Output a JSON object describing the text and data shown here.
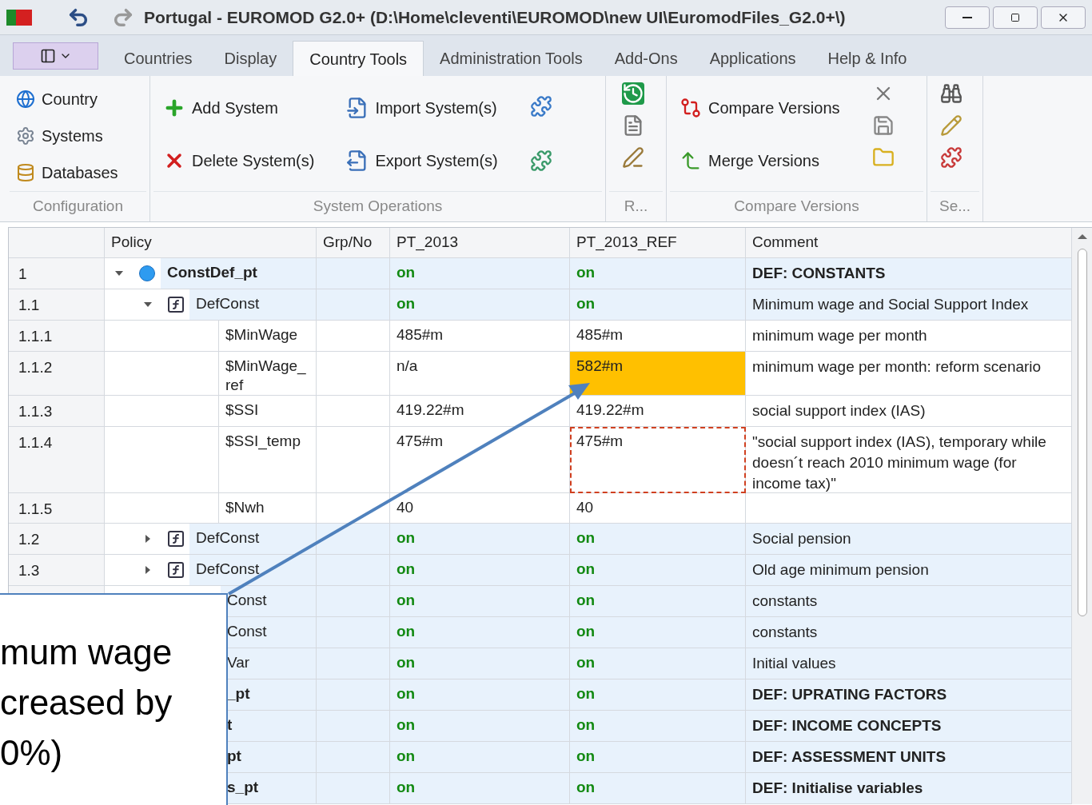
{
  "window": {
    "title": "Portugal - EUROMOD G2.0+ (D:\\Home\\cleventi\\EUROMOD\\new UI\\EuromodFiles_G2.0+\\)"
  },
  "tabs": [
    {
      "label": "Countries",
      "selected": false
    },
    {
      "label": "Display",
      "selected": false
    },
    {
      "label": "Country Tools",
      "selected": true
    },
    {
      "label": "Administration Tools",
      "selected": false
    },
    {
      "label": "Add-Ons",
      "selected": false
    },
    {
      "label": "Applications",
      "selected": false
    },
    {
      "label": "Help & Info",
      "selected": false
    }
  ],
  "ribbon": [
    {
      "label": "Configuration",
      "buttons": [
        "Country",
        "Systems",
        "Databases"
      ]
    },
    {
      "label": "System Operations",
      "buttons": [
        "Add System",
        "Delete System(s)",
        "Import System(s)",
        "Export System(s)"
      ]
    },
    {
      "label": "R..."
    },
    {
      "label": "Compare Versions",
      "buttons": [
        "Compare Versions",
        "Merge Versions"
      ]
    },
    {
      "label": "Se..."
    }
  ],
  "table": {
    "columns": [
      "Policy",
      "Grp/No",
      "PT_2013",
      "PT_2013_REF",
      "Comment"
    ],
    "rows": [
      {
        "number": "1",
        "policy": "ConstDef_pt",
        "kind": "policy",
        "expanded": true,
        "pt_2013": "on",
        "pt_2013_ref": "on",
        "ref_highlighted": false,
        "ref_focused": false,
        "comment": "DEF: CONSTANTS",
        "children": [
          {
            "number": "1.1",
            "policy": "DefConst",
            "kind": "function",
            "expanded": true,
            "pt_2013": "on",
            "pt_2013_ref": "on",
            "ref_highlighted": false,
            "ref_focused": false,
            "comment": "Minimum wage and Social Support Index",
            "children": [
              {
                "number": "1.1.1",
                "policy": "$MinWage",
                "kind": "parameter",
                "pt_2013": "485#m",
                "pt_2013_ref": "485#m",
                "ref_highlighted": false,
                "ref_focused": false,
                "comment": "minimum wage per month"
              },
              {
                "number": "1.1.2",
                "policy": "$MinWage_ref",
                "kind": "parameter",
                "pt_2013": "n/a",
                "pt_2013_ref": "582#m",
                "ref_highlighted": true,
                "ref_focused": false,
                "comment": "minimum wage per month: reform scenario"
              },
              {
                "number": "1.1.3",
                "policy": "$SSI",
                "kind": "parameter",
                "pt_2013": "419.22#m",
                "pt_2013_ref": "419.22#m",
                "ref_highlighted": false,
                "ref_focused": false,
                "comment": "social support index (IAS)"
              },
              {
                "number": "1.1.4",
                "policy": "$SSI_temp",
                "kind": "parameter",
                "pt_2013": "475#m",
                "pt_2013_ref": "475#m",
                "ref_highlighted": false,
                "ref_focused": true,
                "comment": "\"social support index (IAS), temporary while doesn´t reach 2010 minimum wage (for income tax)\""
              },
              {
                "number": "1.1.5",
                "policy": "$Nwh",
                "kind": "parameter",
                "pt_2013": "40",
                "pt_2013_ref": "40",
                "ref_highlighted": false,
                "ref_focused": false
              }
            ]
          },
          {
            "number": "1.2",
            "policy": "DefConst",
            "kind": "function",
            "expanded": false,
            "pt_2013": "on",
            "pt_2013_ref": "on",
            "ref_highlighted": false,
            "ref_focused": false,
            "comment": "Social pension"
          },
          {
            "number": "1.3",
            "policy": "DefConst",
            "kind": "function",
            "expanded": false,
            "pt_2013": "on",
            "pt_2013_ref": "on",
            "ref_highlighted": false,
            "ref_focused": false,
            "comment": "Old age minimum pension"
          },
          {
            "policy": "Const",
            "kind": "clipped",
            "bold": false,
            "pt_2013": "on",
            "pt_2013_ref": "on",
            "ref_highlighted": false,
            "ref_focused": false,
            "comment": "constants"
          },
          {
            "policy": "Const",
            "kind": "clipped",
            "bold": false,
            "pt_2013": "on",
            "pt_2013_ref": "on",
            "ref_highlighted": false,
            "ref_focused": false,
            "comment": "constants"
          },
          {
            "policy": "Var",
            "kind": "clipped",
            "bold": false,
            "pt_2013": "on",
            "pt_2013_ref": "on",
            "ref_highlighted": false,
            "ref_focused": false,
            "comment": "Initial values"
          }
        ]
      },
      {
        "policy": "_pt",
        "kind": "clipped",
        "bold": true,
        "pt_2013": "on",
        "pt_2013_ref": "on",
        "ref_highlighted": false,
        "ref_focused": false,
        "comment": "DEF: UPRATING FACTORS"
      },
      {
        "policy": "t",
        "kind": "clipped",
        "bold": true,
        "pt_2013": "on",
        "pt_2013_ref": "on",
        "ref_highlighted": false,
        "ref_focused": false,
        "comment": "DEF: INCOME CONCEPTS"
      },
      {
        "policy": "pt",
        "kind": "clipped",
        "bold": true,
        "pt_2013": "on",
        "pt_2013_ref": "on",
        "ref_highlighted": false,
        "ref_focused": false,
        "comment": "DEF: ASSESSMENT UNITS"
      },
      {
        "policy": "s_pt",
        "kind": "clipped",
        "bold": true,
        "pt_2013": "on",
        "pt_2013_ref": "on",
        "ref_highlighted": false,
        "ref_focused": false,
        "comment": "DEF: Initialise variables"
      }
    ]
  },
  "callout": {
    "lines": [
      "mum wage",
      "creased by",
      "0%)"
    ]
  }
}
